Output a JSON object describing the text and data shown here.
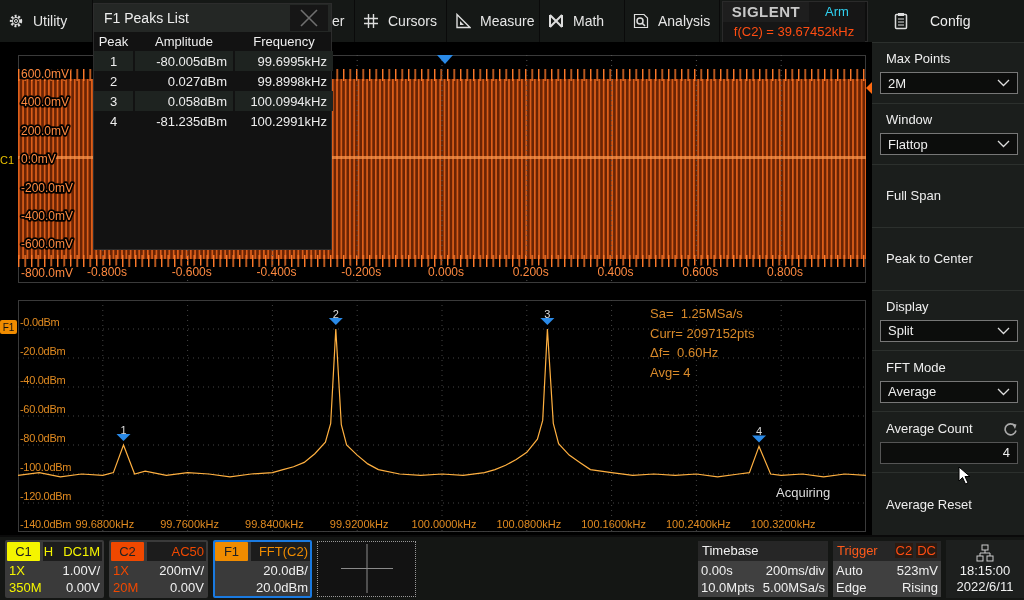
{
  "menu": [
    {
      "label": "Utility"
    },
    {
      "label": "er"
    },
    {
      "label": "Cursors"
    },
    {
      "label": "Measure"
    },
    {
      "label": "Math"
    },
    {
      "label": "Analysis"
    }
  ],
  "brand": {
    "logo": "SIGLENT",
    "state": "Arm",
    "measurement": "f(C2) = 39.67452kHz"
  },
  "peaks_list": {
    "title": "F1 Peaks List",
    "columns": [
      "Peak",
      "Amplitude",
      "Frequency"
    ],
    "rows": [
      {
        "peak": "1",
        "amplitude": "-80.005dBm",
        "frequency": "99.6995kHz"
      },
      {
        "peak": "2",
        "amplitude": "0.027dBm",
        "frequency": "99.8998kHz"
      },
      {
        "peak": "3",
        "amplitude": "0.058dBm",
        "frequency": "100.0994kHz"
      },
      {
        "peak": "4",
        "amplitude": "-81.235dBm",
        "frequency": "100.2991kHz"
      }
    ]
  },
  "time_plot": {
    "channel_label": "C1",
    "y_labels": [
      "600.0mV",
      "400.0mV",
      "200.0mV",
      "0.0mV",
      "-200.0mV",
      "-400.0mV",
      "-600.0mV",
      "-800.0mV"
    ],
    "x_labels": [
      "-0.800s",
      "-0.600s",
      "-0.400s",
      "-0.200s",
      "0.000s",
      "0.200s",
      "0.400s",
      "0.600s",
      "0.800s"
    ]
  },
  "fft_plot": {
    "math_label": "F1",
    "info": [
      "Sa=  1.25MSa/s",
      "Curr= 2097152pts",
      "Δf=  0.60Hz",
      "Avg= 4"
    ],
    "status": "Acquiring",
    "chart_data": {
      "type": "line",
      "grid": true,
      "xlim": [
        99.6,
        100.4
      ],
      "ylim": [
        -140,
        20
      ],
      "xticks": [
        {
          "value": 99.68,
          "label": "99.6800kHz"
        },
        {
          "value": 99.76,
          "label": "99.7600kHz"
        },
        {
          "value": 99.84,
          "label": "99.8400kHz"
        },
        {
          "value": 99.92,
          "label": "99.9200kHz"
        },
        {
          "value": 100.0,
          "label": "100.0000kHz"
        },
        {
          "value": 100.08,
          "label": "100.0800kHz"
        },
        {
          "value": 100.16,
          "label": "100.1600kHz"
        },
        {
          "value": 100.24,
          "label": "100.2400kHz"
        },
        {
          "value": 100.32,
          "label": "100.3200kHz"
        }
      ],
      "yticks": [
        {
          "value": 0,
          "label": "-0.0dBm"
        },
        {
          "value": -20,
          "label": "-20.0dBm"
        },
        {
          "value": -40,
          "label": "-40.0dBm"
        },
        {
          "value": -60,
          "label": "-60.0dBm"
        },
        {
          "value": -80,
          "label": "-80.0dBm"
        },
        {
          "value": -100,
          "label": "-100.0dBm"
        },
        {
          "value": -120,
          "label": "-120.0dBm"
        },
        {
          "value": -140,
          "label": "-140.0dBm"
        }
      ],
      "x": [
        99.6,
        99.62,
        99.64,
        99.66,
        99.68,
        99.69,
        99.6995,
        99.71,
        99.72,
        99.74,
        99.76,
        99.78,
        99.8,
        99.82,
        99.84,
        99.85,
        99.86,
        99.87,
        99.88,
        99.89,
        99.895,
        99.8998,
        99.905,
        99.91,
        99.92,
        99.93,
        99.94,
        99.96,
        99.98,
        100.0,
        100.02,
        100.04,
        100.05,
        100.06,
        100.07,
        100.08,
        100.09,
        100.095,
        100.0994,
        100.105,
        100.11,
        100.12,
        100.13,
        100.14,
        100.16,
        100.18,
        100.2,
        100.22,
        100.24,
        100.26,
        100.28,
        100.29,
        100.2991,
        100.31,
        100.32,
        100.34,
        100.36,
        100.38,
        100.4
      ],
      "series": [
        {
          "color": "#ffb040",
          "values": [
            -101,
            -99,
            -102,
            -100,
            -101,
            -99,
            -80,
            -100,
            -98,
            -101,
            -99,
            -100,
            -102,
            -100,
            -99,
            -97,
            -95,
            -92,
            -86,
            -78,
            -65,
            0,
            -66,
            -80,
            -87,
            -93,
            -97,
            -100,
            -101,
            -100,
            -101,
            -99,
            -97,
            -94,
            -90,
            -85,
            -76,
            -63,
            0,
            -65,
            -79,
            -87,
            -92,
            -97,
            -99,
            -101,
            -100,
            -101,
            -100,
            -102,
            -100,
            -99,
            -81,
            -100,
            -101,
            -100,
            -102,
            -100,
            -101
          ]
        }
      ],
      "annotations": [
        {
          "x": 99.6995,
          "y": -80,
          "text": "1"
        },
        {
          "x": 99.8998,
          "y": 0,
          "text": "2"
        },
        {
          "x": 100.0994,
          "y": 0,
          "text": "3"
        },
        {
          "x": 100.2991,
          "y": -81,
          "text": "4"
        }
      ]
    }
  },
  "config": {
    "title": "Config",
    "items": [
      {
        "kind": "dropdown",
        "label": "Max Points",
        "value": "2M"
      },
      {
        "kind": "dropdown",
        "label": "Window",
        "value": "Flattop"
      },
      {
        "kind": "button",
        "label": "Full Span"
      },
      {
        "kind": "button",
        "label": "Peak to Center"
      },
      {
        "kind": "dropdown",
        "label": "Display",
        "value": "Split"
      },
      {
        "kind": "dropdown",
        "label": "FFT Mode",
        "value": "Average"
      },
      {
        "kind": "number",
        "label": "Average Count",
        "value": "4"
      },
      {
        "kind": "button",
        "label": "Average Reset"
      }
    ]
  },
  "channels": [
    {
      "kind": "analog",
      "name": "C1",
      "color": "#f5f500",
      "tag": "H",
      "coupling": "DC1M",
      "probe": "1X",
      "scale": "1.00V/",
      "bandwidth": "350M",
      "offset": "0.00V",
      "selected": false
    },
    {
      "kind": "analog",
      "name": "C2",
      "color": "#f04800",
      "coupling": "AC50",
      "probe": "1X",
      "scale": "200mV/",
      "bandwidth": "20M",
      "offset": "0.00V",
      "selected": false
    },
    {
      "kind": "math",
      "name": "F1",
      "color": "#f08c00",
      "source": "FFT(C2)",
      "scale": "20.0dB/",
      "offset": "20.0dBm",
      "selected": true
    }
  ],
  "timebase": {
    "title": "Timebase",
    "delay": "0.00s",
    "scale": "200ms/div",
    "memory": "10.0Mpts",
    "sample_rate": "5.00MSa/s"
  },
  "trigger": {
    "title": "Trigger",
    "source": "C2",
    "coupling": "DC",
    "mode": "Auto",
    "voltage": "523mV",
    "type": "Edge",
    "slope": "Rising"
  },
  "clock": {
    "time": "18:15:00",
    "date": "2022/6/11"
  }
}
